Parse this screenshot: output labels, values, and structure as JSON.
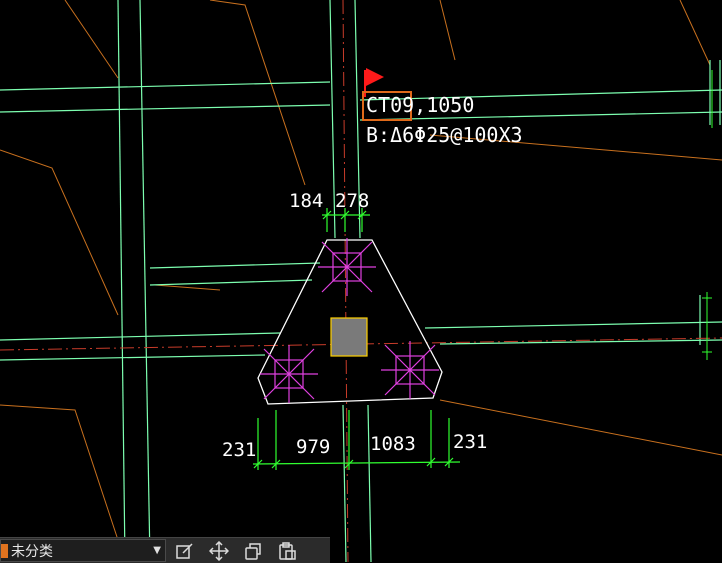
{
  "drawing": {
    "cap_label": "CT09,1050",
    "reinforcement_label": "B:Δ6Φ25@100X3",
    "dim_top": [
      "184",
      "278"
    ],
    "dim_bottom": [
      "231",
      "979",
      "1083",
      "231"
    ]
  },
  "colors": {
    "background": "#000000",
    "grid_green": "#7dffb0",
    "orange_line": "#c8701e",
    "magenta_pile": "#e040e0",
    "dim_green": "#30ff30",
    "highlight_box": "#e06a1a",
    "flag": "#ff1a1a"
  },
  "toolbar": {
    "layer_value": "未分类",
    "icons": [
      "edit-icon",
      "move-icon",
      "copy-icon",
      "paste-icon"
    ]
  }
}
